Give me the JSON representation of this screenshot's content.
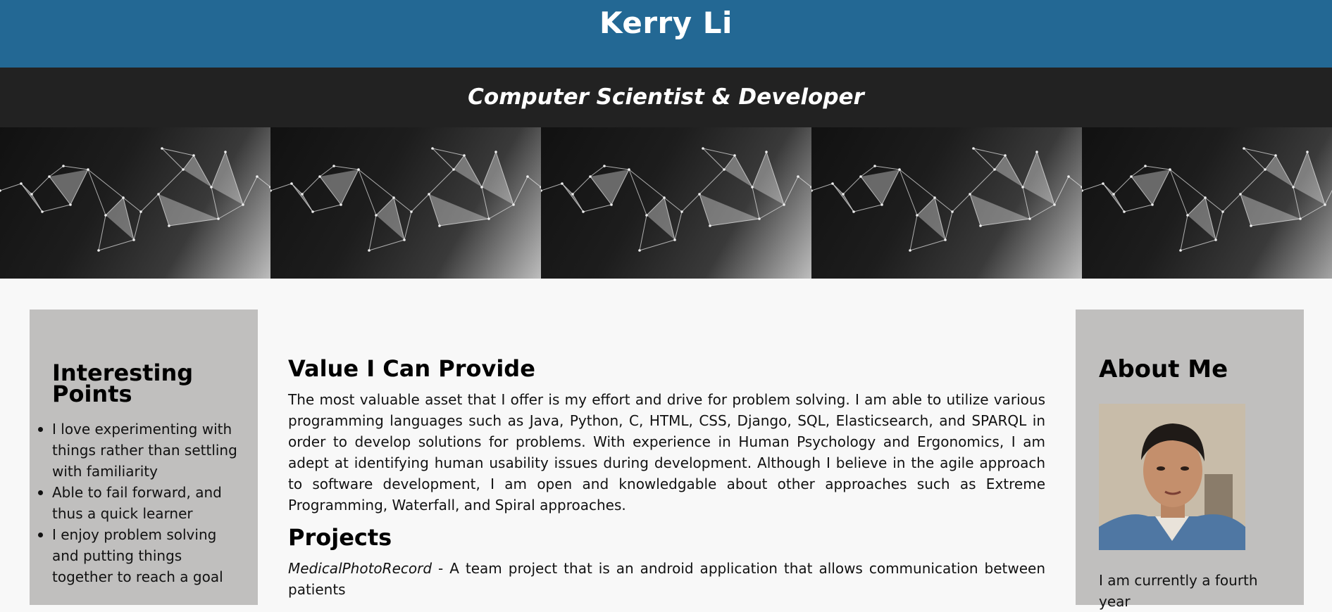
{
  "header": {
    "name": "Kerry Li",
    "subtitle": "Computer Scientist & Developer"
  },
  "banner": {
    "image": "polygon-network-pattern",
    "tile_count": 5
  },
  "sidebar_left": {
    "title": "Interesting Points",
    "items": [
      "I love experimenting with things rather than settling with familiarity",
      "Able to fail forward, and thus a quick learner",
      "I enjoy problem solving and putting things together to reach a goal"
    ]
  },
  "main": {
    "value_heading": "Value I Can Provide",
    "value_text": "The most valuable asset that I offer is my effort and drive for problem solving. I am able to utilize various programming languages such as Java, Python, C, HTML, CSS, Django, SQL, Elasticsearch, and SPARQL in order to develop solutions for problems. With experience in Human Psychology and Ergonomics, I am adept at identifying human usability issues during development. Although I believe in the agile approach to software development, I am open and knowledgable about other approaches such as Extreme Programming, Waterfall, and Spiral approaches.",
    "projects_heading": "Projects",
    "projects": [
      {
        "name": "MedicalPhotoRecord",
        "description": " - A team project that is an android application that allows communication between patients"
      }
    ]
  },
  "sidebar_right": {
    "title": "About Me",
    "photo": "profile-photo",
    "intro": "I am currently a fourth year"
  },
  "colors": {
    "header_bg": "#236894",
    "subheader_bg": "#222222",
    "sidebar_bg": "#c0bfbe",
    "page_bg": "#f8f8f8"
  }
}
